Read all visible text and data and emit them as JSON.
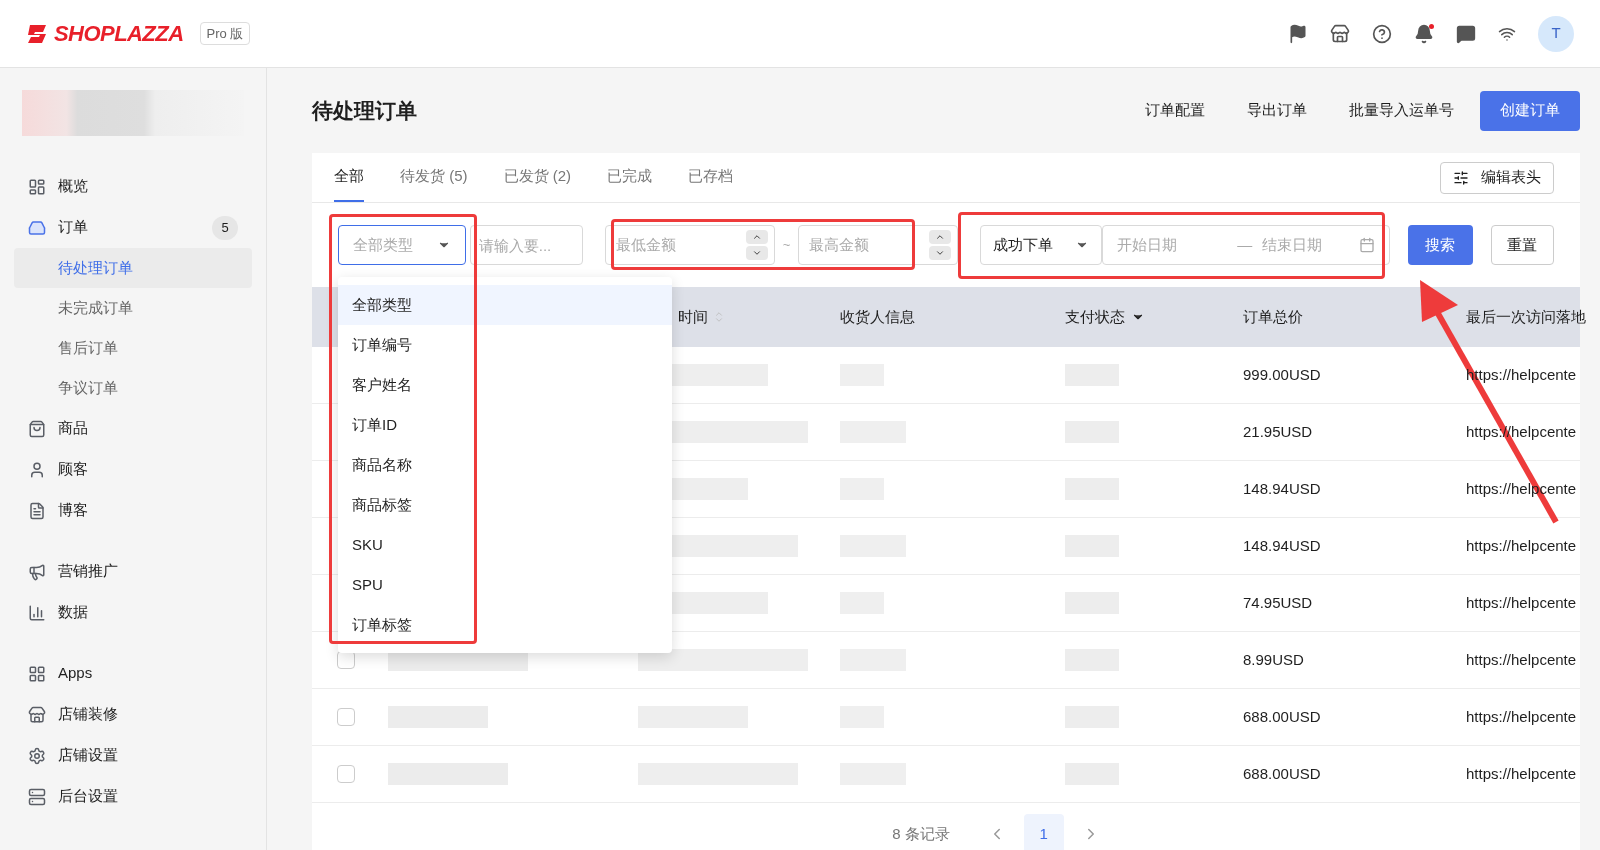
{
  "header": {
    "logo": "SHOPLAZZA",
    "plan": "Pro 版",
    "notification_unread": true,
    "avatar": "T"
  },
  "sidebar": {
    "groups": [
      [
        {
          "label": "概览",
          "selected": false
        },
        {
          "label": "订单",
          "selected": true,
          "badge": "5",
          "children": [
            {
              "label": "待处理订单",
              "selected": true
            },
            {
              "label": "未完成订单",
              "selected": false
            },
            {
              "label": "售后订单",
              "selected": false
            },
            {
              "label": "争议订单",
              "selected": false
            }
          ]
        },
        {
          "label": "商品",
          "selected": false
        },
        {
          "label": "顾客",
          "selected": false
        },
        {
          "label": "博客",
          "selected": false
        }
      ],
      [
        {
          "label": "营销推广",
          "selected": false
        },
        {
          "label": "数据",
          "selected": false
        }
      ],
      [
        {
          "label": "Apps",
          "selected": false
        },
        {
          "label": "店铺装修",
          "selected": false
        },
        {
          "label": "店铺设置",
          "selected": false
        },
        {
          "label": "后台设置",
          "selected": false
        }
      ]
    ]
  },
  "page": {
    "title": "待处理订单",
    "actions": [
      "订单配置",
      "导出订单",
      "批量导入运单号"
    ],
    "primary_action": "创建订单"
  },
  "tabs": [
    {
      "label": "全部",
      "selected": true
    },
    {
      "label": "待发货 (5)",
      "selected": false
    },
    {
      "label": "已发货 (2)",
      "selected": false
    },
    {
      "label": "已完成",
      "selected": false
    },
    {
      "label": "已存档",
      "selected": false
    }
  ],
  "edit_columns": "编辑表头",
  "filters": {
    "type_select": {
      "value": "全部类型",
      "focused": true
    },
    "keyword": {
      "placeholder": "请输入要..."
    },
    "min_amount": {
      "placeholder": "最低金额"
    },
    "separator": "~",
    "max_amount": {
      "placeholder": "最高金额"
    },
    "date_type": {
      "value": "成功下单"
    },
    "start_date": {
      "placeholder": "开始日期"
    },
    "date_separator": "—",
    "end_date": {
      "placeholder": "结束日期"
    },
    "search": "搜索",
    "reset": "重置"
  },
  "dropdown": [
    {
      "label": "全部类型",
      "selected": true
    },
    {
      "label": "订单编号",
      "selected": false
    },
    {
      "label": "客户姓名",
      "selected": false
    },
    {
      "label": "订单ID",
      "selected": false
    },
    {
      "label": "商品名称",
      "selected": false
    },
    {
      "label": "商品标签",
      "selected": false
    },
    {
      "label": "SKU",
      "selected": false
    },
    {
      "label": "SPU",
      "selected": false
    },
    {
      "label": "订单标签",
      "selected": false
    }
  ],
  "table": {
    "columns": [
      {
        "label": "时间",
        "kind": "sortable"
      },
      {
        "label": "收货人信息",
        "kind": "plain"
      },
      {
        "label": "支付状态",
        "kind": "filter"
      },
      {
        "label": "订单总价",
        "kind": "plain"
      },
      {
        "label": "最后一次访问落地",
        "kind": "plain"
      }
    ],
    "rows": [
      {
        "total": "999.00USD",
        "landing": "https://helpcente"
      },
      {
        "total": "21.95USD",
        "landing": "https://helpcente"
      },
      {
        "total": "148.94USD",
        "landing": "https://helpcente"
      },
      {
        "total": "148.94USD",
        "landing": "https://helpcente"
      },
      {
        "total": "74.95USD",
        "landing": "https://helpcente"
      },
      {
        "total": "8.99USD",
        "landing": "https://helpcente",
        "checked": false
      },
      {
        "total": "688.00USD",
        "landing": "https://helpcente",
        "checked": false
      },
      {
        "total": "688.00USD",
        "landing": "https://helpcente",
        "checked": false
      }
    ]
  },
  "pagination": {
    "summary": "8 条记录",
    "pages": [
      {
        "label": "1",
        "selected": true
      }
    ]
  }
}
